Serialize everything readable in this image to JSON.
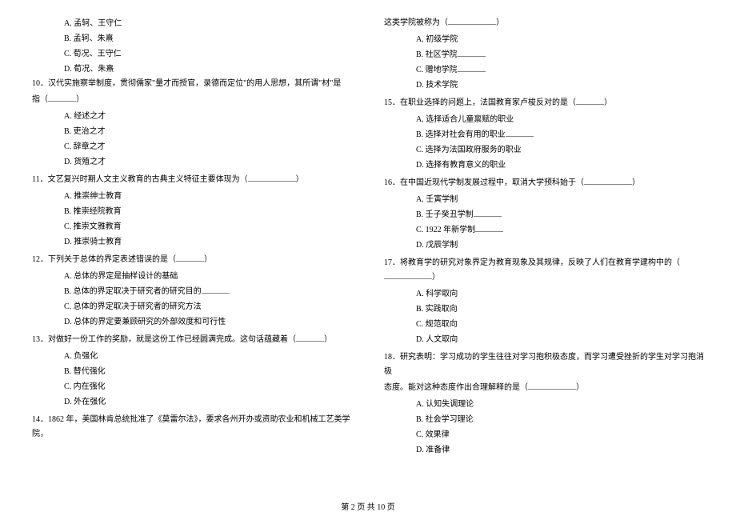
{
  "left_column": {
    "q9_options": [
      "A. 孟轲、王守仁",
      "B. 孟轲、朱熹",
      "C. 荀况、王守仁",
      "D. 荀况、朱熹"
    ],
    "q10": {
      "text_prefix": "10．汉代实施察举制度，贯彻儒家\"量才而授官，录德而定位\"的用人思想，其所谓\"材\"是",
      "text_suffix": "指（",
      "options": [
        "A. 经述之才",
        "B. 吏治之才",
        "C. 辞章之才",
        "D. 货殖之才"
      ]
    },
    "q11": {
      "text": "11．文艺复兴时期人文主义教育的古典主义特征主要体现为（",
      "options": [
        "A. 推崇绅士教育",
        "B. 推崇经院教育",
        "C. 推崇文雅教育",
        "D. 推崇骑士教育"
      ]
    },
    "q12": {
      "text": "12．下列关于总体的界定表述错误的是（",
      "options": [
        "A. 总体的界定是抽样设计的基础",
        "B. 总体的界定取决于研究者的研究目的",
        "C. 总体的界定取决于研究者的研究方法",
        "D. 总体的界定要兼顾研究的外部效度和可行性"
      ]
    },
    "q13": {
      "text": "13．对做好一份工作的奖励，就是这份工作已经圆满完成。这句话蕴藏着（",
      "options": [
        "A. 负强化",
        "B. 替代强化",
        "C. 内在强化",
        "D. 外在强化"
      ]
    },
    "q14": {
      "text": "14．1862 年，美国林肯总统批准了《莫雷尔法》，要求各州开办或资助农业和机械工艺类学院，"
    }
  },
  "right_column": {
    "q14_cont": {
      "text": "这类学院被称为（",
      "options": [
        "A. 初级学院",
        "B. 社区学院",
        "C. 赠地学院",
        "D. 技术学院"
      ]
    },
    "q15": {
      "text": "15．在职业选择的问题上，法国教育家卢梭反对的是（",
      "options": [
        "A. 选择适合儿童禀赋的职业",
        "B. 选择对社会有用的职业",
        "C. 选择为法国政府服务的职业",
        "D. 选择有教育意义的职业"
      ]
    },
    "q16": {
      "text": "16．在中国近现代学制发展过程中，取消大学预科始于（",
      "options": [
        "A. 壬寅学制",
        "B. 壬子癸丑学制",
        "C. 1922 年新学制",
        "D. 戊辰学制"
      ]
    },
    "q17": {
      "text": "17．将教育学的研究对象界定为教育现象及其规律，反映了人们在教育学建构中的（",
      "options": [
        "A. 科学取向",
        "B. 实践取向",
        "C. 规范取向",
        "D. 人文取向"
      ]
    },
    "q18": {
      "text_line1": "18．研究表明：学习成功的学生往往对学习抱积极态度，而学习遭受挫折的学生对学习抱消极",
      "text_line2": "态度。能对这种态度作出合理解释的是（",
      "options": [
        "A. 认知失调理论",
        "B. 社会学习理论",
        "C. 效果律",
        "D. 准备律"
      ]
    }
  },
  "footer": "第 2 页 共 10 页"
}
